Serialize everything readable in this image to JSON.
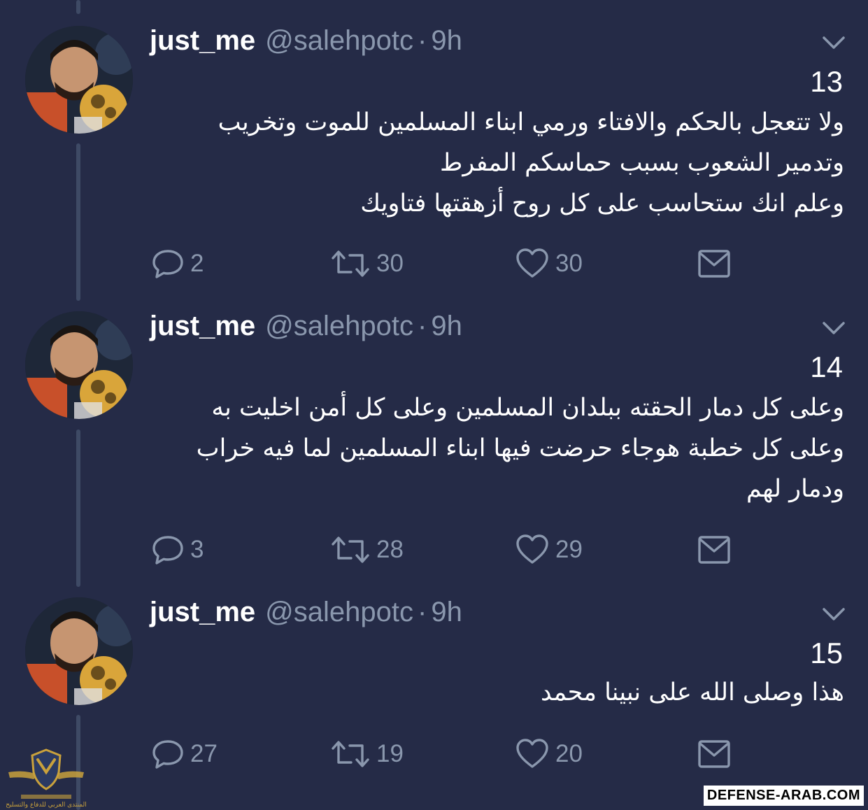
{
  "colors": {
    "background": "#252b47",
    "secondary_text": "#8a97ad",
    "thread_line": "#3e4a65"
  },
  "tweets": [
    {
      "name": "just_me",
      "handle": "@salehpotc",
      "separator": "·",
      "time": "9h",
      "number": "13",
      "lines": [
        "ولا تتعجل بالحكم والافتاء ورمي ابناء المسلمين للموت وتخريب",
        "وتدمير الشعوب بسبب حماسكم المفرط",
        "وعلم انك ستحاسب على كل روح أزهقتها فتاويك"
      ],
      "replies": "2",
      "retweets": "30",
      "likes": "30"
    },
    {
      "name": "just_me",
      "handle": "@salehpotc",
      "separator": "·",
      "time": "9h",
      "number": "14",
      "lines": [
        "وعلى كل دمار الحقته ببلدان المسلمين وعلى كل أمن اخليت به",
        "وعلى كل خطبة هوجاء حرضت فيها ابناء المسلمين لما فيه خراب",
        "ودمار لهم"
      ],
      "replies": "3",
      "retweets": "28",
      "likes": "29"
    },
    {
      "name": "just_me",
      "handle": "@salehpotc",
      "separator": "·",
      "time": "9h",
      "number": "15",
      "lines": [
        "هذا وصلى الله على نبينا محمد"
      ],
      "replies": "27",
      "retweets": "19",
      "likes": "20"
    }
  ],
  "icons": {
    "reply": "reply-icon",
    "retweet": "retweet-icon",
    "like": "heart-icon",
    "dm": "mail-icon",
    "caret": "chevron-down-icon"
  },
  "watermark": {
    "site": "DEFENSE-ARAB.COM",
    "logo_caption": "المنتدى العربي للدفاع والتسليح"
  }
}
